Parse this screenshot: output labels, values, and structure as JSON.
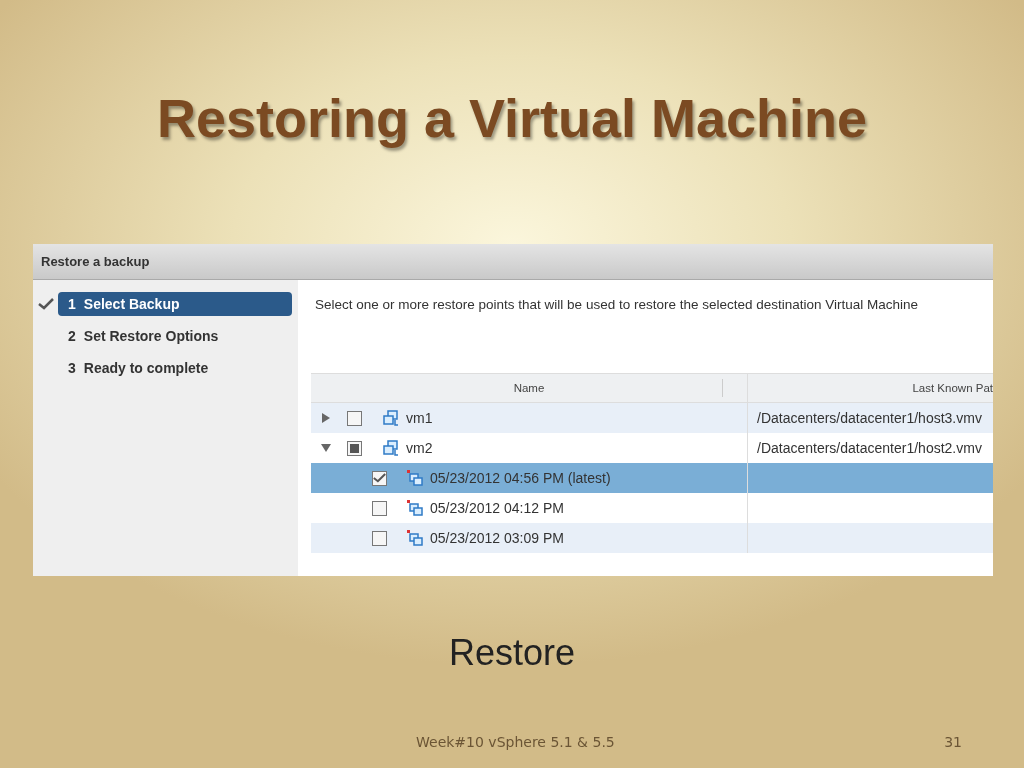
{
  "slide": {
    "title": "Restoring a Virtual Machine",
    "caption": "Restore",
    "footer": "Week#10  vSphere 5.1 & 5.5",
    "page_number": "31"
  },
  "dialog": {
    "title": "Restore a backup",
    "steps": [
      {
        "number": "1",
        "label": "Select Backup",
        "selected": true,
        "done": true
      },
      {
        "number": "2",
        "label": "Set Restore Options",
        "selected": false,
        "done": false
      },
      {
        "number": "3",
        "label": "Ready to complete",
        "selected": false,
        "done": false
      }
    ],
    "instruction": "Select one or more restore points that will be used to restore the selected destination Virtual Machine",
    "table": {
      "columns": [
        "Name",
        "Last Known Pat"
      ],
      "rows": [
        {
          "kind": "vm",
          "name": "vm1",
          "path": "/Datacenters/datacenter1/host3.vmv",
          "checked": false,
          "indeterminate": false,
          "expanded": false,
          "selected": false
        },
        {
          "kind": "vm",
          "name": "vm2",
          "path": "/Datacenters/datacenter1/host2.vmv",
          "checked": false,
          "indeterminate": true,
          "expanded": true,
          "selected": false,
          "children": [
            {
              "kind": "restore-point",
              "name": "05/23/2012 04:56 PM (latest)",
              "checked": true,
              "selected": true
            },
            {
              "kind": "restore-point",
              "name": "05/23/2012 04:12 PM",
              "checked": false,
              "selected": false
            },
            {
              "kind": "restore-point",
              "name": "05/23/2012 03:09 PM",
              "checked": false,
              "selected": false
            }
          ]
        }
      ]
    }
  }
}
